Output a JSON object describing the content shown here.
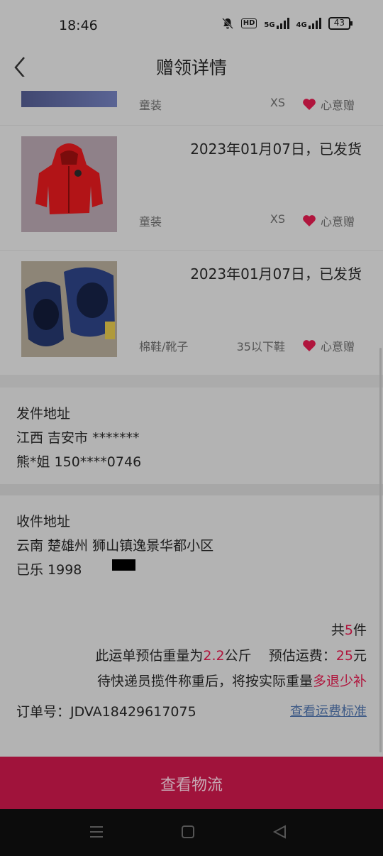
{
  "status": {
    "time": "18:46",
    "hd": "HD",
    "net1": "5G",
    "net2": "4G",
    "battery": "43"
  },
  "header": {
    "title": "赠领详情"
  },
  "items": [
    {
      "date": "",
      "category": "童装",
      "size": "XS",
      "tag": "心意赠"
    },
    {
      "date": "2023年01月07日，已发货",
      "category": "童装",
      "size": "XS",
      "tag": "心意赠"
    },
    {
      "date": "2023年01月07日，已发货",
      "category": "棉鞋/靴子",
      "size": "35以下鞋",
      "tag": "心意赠"
    }
  ],
  "sender": {
    "title": "发件地址",
    "region": "江西 吉安市 *******",
    "contact": "熊*姐 150****0746"
  },
  "receiver": {
    "title": "收件地址",
    "address": "云南 楚雄州 狮山镇逸景华都小区",
    "contact": "已乐 1998"
  },
  "summary": {
    "count_prefix": "共",
    "count": "5",
    "count_suffix": "件",
    "weight_prefix": "此运单预估重量为",
    "weight": "2.2",
    "weight_unit": "公斤",
    "fee_label": "预估运费：",
    "fee": "25",
    "fee_unit": "元",
    "note_prefix": "待快递员揽件称重后，将按实际重量",
    "note_highlight": "多退少补",
    "order_label": "订单号：",
    "order_no": "JDVA18429617075",
    "fee_link": "查看运费标准"
  },
  "cta": {
    "label": "查看物流"
  },
  "colors": {
    "accent": "#b0153d",
    "button": "#a0133b",
    "link": "#3e5a86"
  }
}
